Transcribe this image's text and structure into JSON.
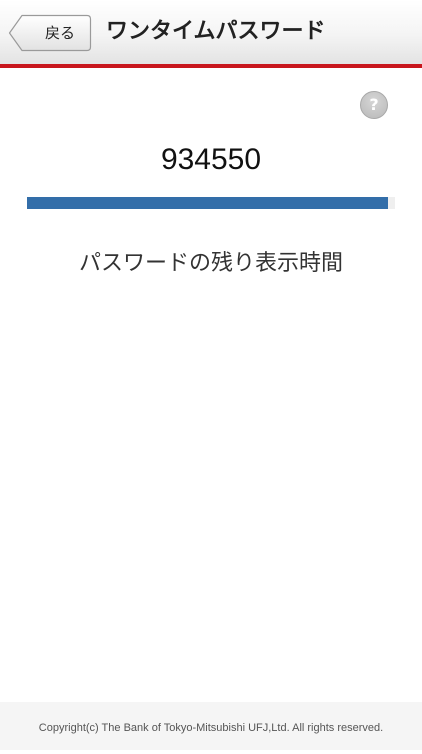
{
  "header": {
    "back_label": "戻る",
    "title": "ワンタイムパスワード"
  },
  "help": {
    "icon": "question-icon",
    "glyph": "?"
  },
  "otp": {
    "password": "934550",
    "remaining_fraction": 0.98,
    "caption": "パスワードの残り表示時間"
  },
  "footer": {
    "copyright": "Copyright(c) The Bank of Tokyo-Mitsubishi UFJ,Ltd. All rights reserved."
  },
  "colors": {
    "accent_line": "#c8161d",
    "progress_fill": "#336ea9",
    "progress_track": "#efefef"
  }
}
